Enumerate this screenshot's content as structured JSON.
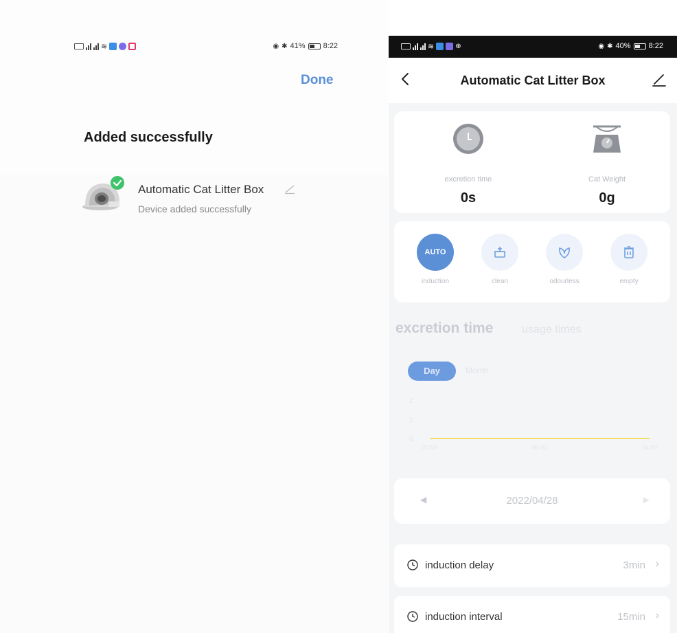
{
  "left_screen": {
    "status_bar": {
      "battery": "41%",
      "time": "8:22"
    },
    "done_label": "Done",
    "title": "Added successfully",
    "device": {
      "name": "Automatic Cat Litter Box",
      "subtitle": "Device added successfully"
    }
  },
  "right_screen": {
    "status_bar": {
      "battery": "40%",
      "time": "8:22"
    },
    "nav": {
      "title": "Automatic Cat Litter Box"
    },
    "stats": [
      {
        "label": "excretion time",
        "value": "0s",
        "icon": "clock-icon"
      },
      {
        "label": "Cat Weight",
        "value": "0g",
        "icon": "scale-icon"
      }
    ],
    "modes": [
      {
        "label": "induction",
        "icon_text": "AUTO",
        "icon": "auto-icon",
        "active": true
      },
      {
        "label": "clean",
        "icon": "clean-icon",
        "active": false
      },
      {
        "label": "odourless",
        "icon": "leaf-icon",
        "active": false
      },
      {
        "label": "empty",
        "icon": "trash-icon",
        "active": false
      }
    ],
    "tabs": {
      "active": "excretion time",
      "inactive": "usage times"
    },
    "period": {
      "day": "Day",
      "month": "Month"
    },
    "chart_data": {
      "type": "line",
      "x": [
        "00:00",
        "06:00",
        "24:00"
      ],
      "y_ticks": [
        "2",
        "1",
        "0"
      ],
      "series": [
        {
          "values": [
            0,
            0,
            0
          ]
        }
      ],
      "ylim": [
        0,
        2
      ]
    },
    "date": "2022/04/28",
    "settings": [
      {
        "label": "induction delay",
        "value": "3min"
      },
      {
        "label": "induction interval",
        "value": "15min"
      }
    ],
    "colors": {
      "accent": "#5b8fd6",
      "chart_line": "#f3dc63",
      "status_bar": "#111111"
    }
  }
}
